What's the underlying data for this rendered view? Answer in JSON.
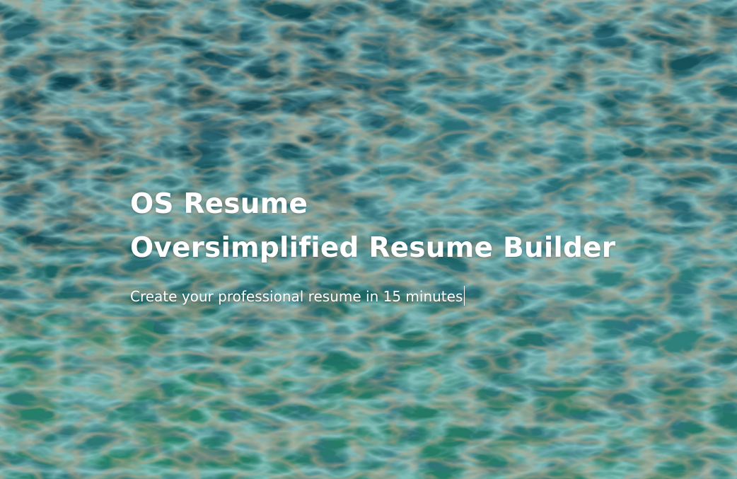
{
  "hero": {
    "title_line1": "OS Resume",
    "title_line2": "Oversimplified Resume Builder",
    "subtitle": "Create your professional resume in 15 minutes"
  },
  "colors": {
    "deep_teal": "#0f4a55",
    "teal": "#1e6f6c",
    "sea_green": "#2e8b72",
    "aqua": "#6ec9c4",
    "copper": "#b9784a",
    "text": "#ffffff"
  },
  "background": {
    "description_icon": "marbled-fluid-art-background"
  }
}
